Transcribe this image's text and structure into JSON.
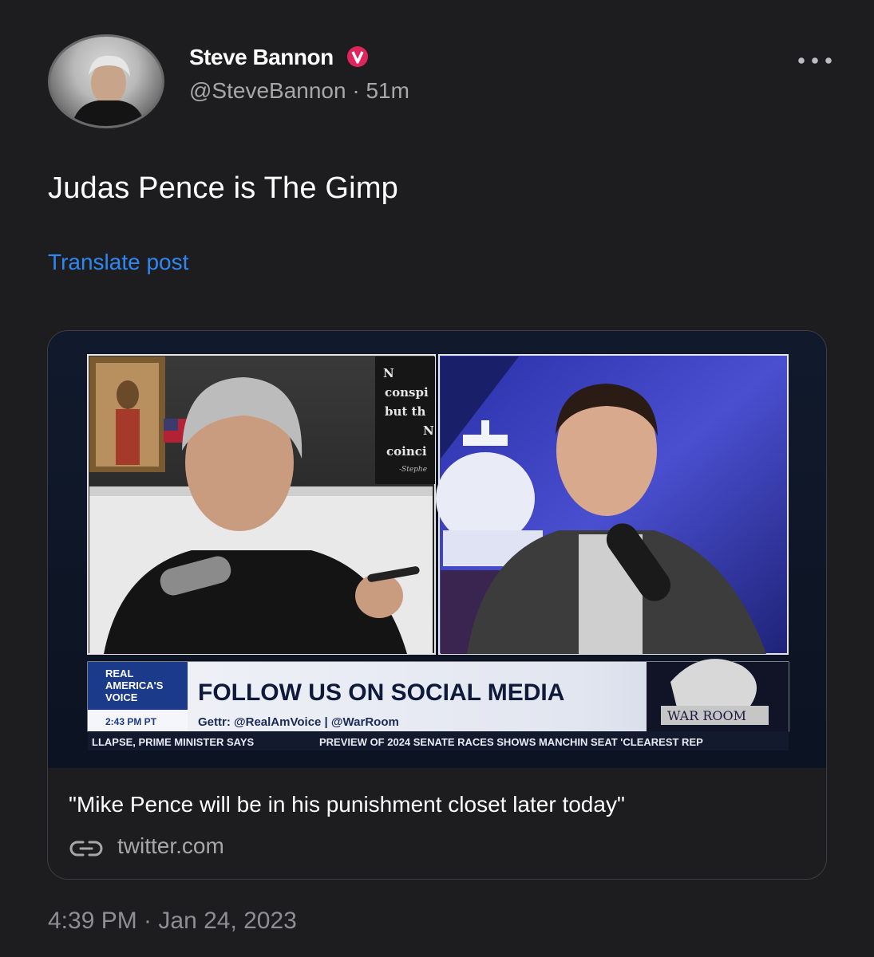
{
  "author": {
    "name": "Steve Bannon",
    "verified_badge_glyph": "v",
    "handle": "@SteveBannon",
    "time_ago": "51m",
    "handle_line": "@SteveBannon · 51m"
  },
  "post": {
    "text": "Judas Pence is The Gimp",
    "translate_label": "Translate post",
    "timestamp": "4:39 PM · Jan 24, 2023"
  },
  "card": {
    "title": "\"Mike Pence will be in his punishment closet later today\"",
    "domain": "twitter.com",
    "media": {
      "shelf_sign": [
        "N",
        "conspi",
        "but th",
        "N",
        "coinci",
        "-Stephe"
      ],
      "network_logo": [
        "REAL",
        "AMERICA'S",
        "VOICE"
      ],
      "banner_headline": "FOLLOW US ON SOCIAL MEDIA",
      "clock": "2:43 PM PT",
      "banner_subtext": "Gettr: @RealAmVoice | @WarRoom",
      "show_logo": "WAR ROOM",
      "ticker_left": "LLAPSE, PRIME MINISTER SAYS",
      "ticker_right": "PREVIEW OF 2024 SENATE RACES SHOWS MANCHIN SEAT 'CLEAREST REP"
    }
  },
  "colors": {
    "background": "#1d1d1f",
    "link_blue": "#2f87f2",
    "secondary_text": "#a7a7aa",
    "verified_red": "#e0245e",
    "banner_blue": "#1b3a8a"
  },
  "icons": {
    "verified": "verified-badge-icon",
    "more": "more-horizontal-icon",
    "link": "link-icon"
  }
}
